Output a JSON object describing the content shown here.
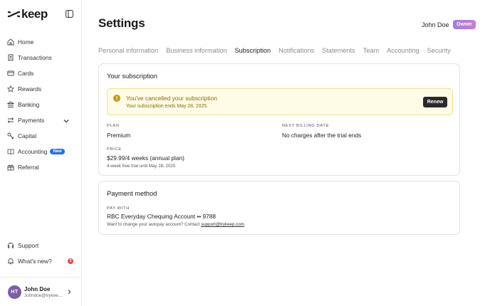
{
  "brand": {
    "name": "keep"
  },
  "sidebar": {
    "items": [
      {
        "label": "Home",
        "icon": "home-icon"
      },
      {
        "label": "Transactions",
        "icon": "receipt-icon"
      },
      {
        "label": "Cards",
        "icon": "card-icon"
      },
      {
        "label": "Rewards",
        "icon": "star-icon"
      },
      {
        "label": "Banking",
        "icon": "bank-icon"
      },
      {
        "label": "Payments",
        "icon": "transfer-icon"
      },
      {
        "label": "Capital",
        "icon": "capital-icon"
      },
      {
        "label": "Accounting",
        "icon": "book-icon",
        "badge": "New"
      },
      {
        "label": "Referral",
        "icon": "gift-icon"
      }
    ],
    "bottom": [
      {
        "label": "Support",
        "icon": "headset-icon"
      },
      {
        "label": "What's new?",
        "icon": "bell-icon",
        "count": "3"
      }
    ],
    "user": {
      "initials": "HT",
      "name": "John Doe",
      "email": "Johndoe@trykeep.com"
    }
  },
  "header": {
    "title": "Settings",
    "user_name": "John Doe",
    "role_badge": "Owner"
  },
  "tabs": [
    {
      "label": "Personal information",
      "active": false
    },
    {
      "label": "Business information",
      "active": false
    },
    {
      "label": "Subscription",
      "active": true
    },
    {
      "label": "Notifications",
      "active": false
    },
    {
      "label": "Statements",
      "active": false
    },
    {
      "label": "Team",
      "active": false
    },
    {
      "label": "Accounting",
      "active": false
    },
    {
      "label": "Security",
      "active": false
    }
  ],
  "subscription": {
    "title": "Your subscription",
    "alert": {
      "title": "You've cancelled your subscription",
      "text": "Your subscription ends May 28, 2025.",
      "button": "Renew"
    },
    "plan_label": "PLAN",
    "plan_value": "Premium",
    "billing_label": "NEXT BILLING DATE",
    "billing_value": "No charges after the trial ends",
    "price_label": "PRICE",
    "price_value": "$29.99/4 weeks (annual plan)",
    "price_note": "4-week free trial until May 28, 2025"
  },
  "payment": {
    "title": "Payment method",
    "label": "PAY WITH",
    "value": "RBC Everyday Chequing Account •• 9788",
    "note_prefix": "Want to change your autopay account? Contact ",
    "note_link": "support@trykeep.com",
    "note_suffix": "."
  },
  "colors": {
    "accent": "#1d6ff2",
    "alert_bg": "#fefbe6",
    "alert_text": "#8f6a0a",
    "badge_red": "#e5484d"
  }
}
